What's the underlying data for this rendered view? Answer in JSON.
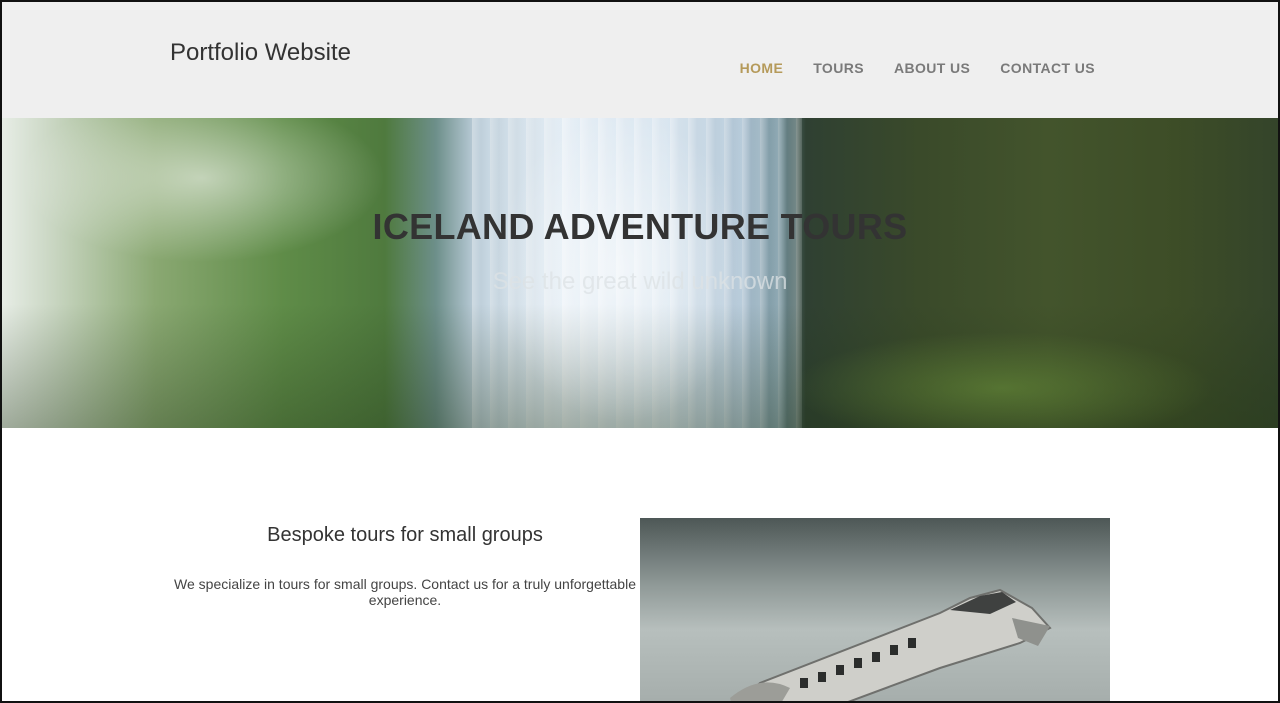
{
  "header": {
    "brand": "Portfolio Website",
    "nav": [
      {
        "label": "HOME",
        "active": true
      },
      {
        "label": "TOURS",
        "active": false
      },
      {
        "label": "ABOUT US",
        "active": false
      },
      {
        "label": "CONTACT US",
        "active": false
      }
    ]
  },
  "hero": {
    "title": "ICELAND ADVENTURE TOURS",
    "subtitle": "See the great wild unknown"
  },
  "feature": {
    "title": "Bespoke tours for small groups",
    "text": "We specialize in tours for small groups. Contact us for a truly unforgettable experience."
  },
  "colors": {
    "nav_active": "#b59a5a",
    "nav_default": "#7a7a7a",
    "header_bg": "#efefef"
  }
}
